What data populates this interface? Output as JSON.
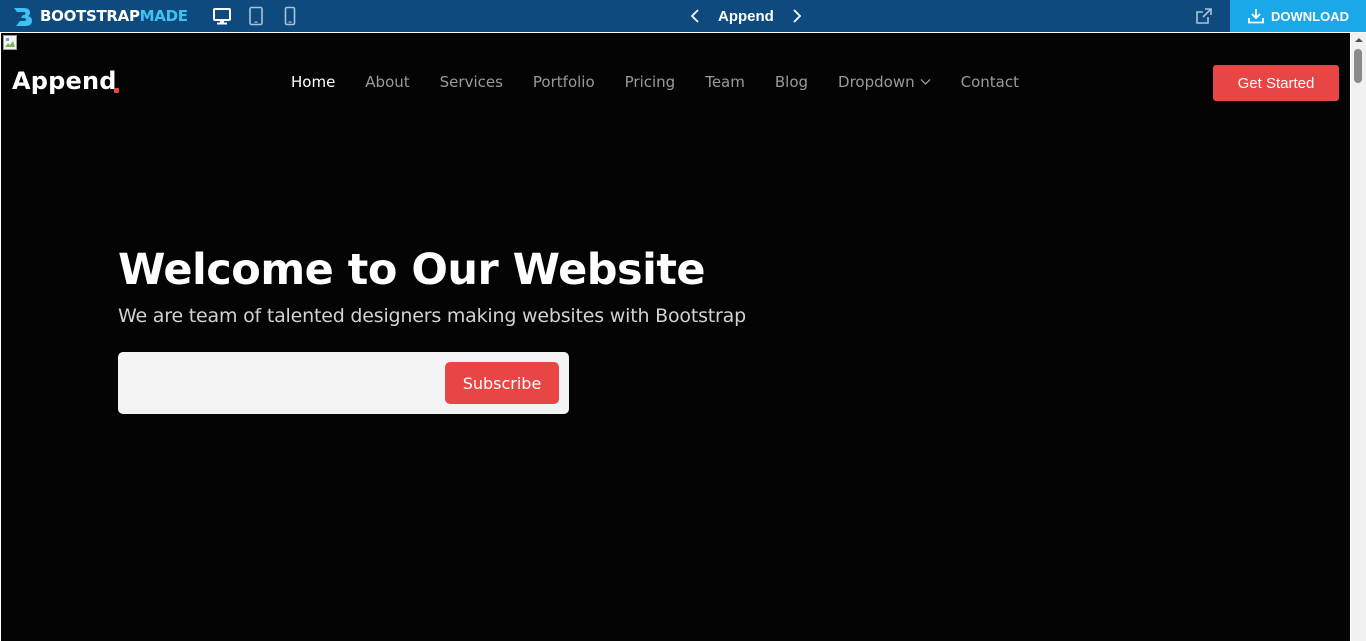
{
  "topbar": {
    "brand_part1": "BOOTSTRAP",
    "brand_part2": "MADE",
    "brand_icon": "bootstrapmade-logo",
    "devices": [
      {
        "name": "desktop-icon"
      },
      {
        "name": "tablet-icon"
      },
      {
        "name": "mobile-icon"
      }
    ],
    "template_title": "Append",
    "prev_icon": "chevron-left-icon",
    "next_icon": "chevron-right-icon",
    "external_icon": "external-link-icon",
    "download_label": "DOWNLOAD",
    "download_icon": "download-icon",
    "colors": {
      "bar": "#0e4a7e",
      "download_bg": "#1aa8e8",
      "brand_accent": "#3ec1f3"
    }
  },
  "site": {
    "logo": "Append",
    "logo_dot_color": "#e84545",
    "nav": [
      {
        "label": "Home",
        "active": true
      },
      {
        "label": "About"
      },
      {
        "label": "Services"
      },
      {
        "label": "Portfolio"
      },
      {
        "label": "Pricing"
      },
      {
        "label": "Team"
      },
      {
        "label": "Blog"
      },
      {
        "label": "Dropdown",
        "icon": "chevron-down-icon"
      },
      {
        "label": "Contact"
      }
    ],
    "cta_label": "Get Started",
    "hero": {
      "title": "Welcome to Our Website",
      "subtitle": "We are team of talented designers making websites with Bootstrap",
      "email_placeholder": "",
      "subscribe_label": "Subscribe"
    },
    "colors": {
      "background": "#040404",
      "accent": "#e84545"
    }
  }
}
